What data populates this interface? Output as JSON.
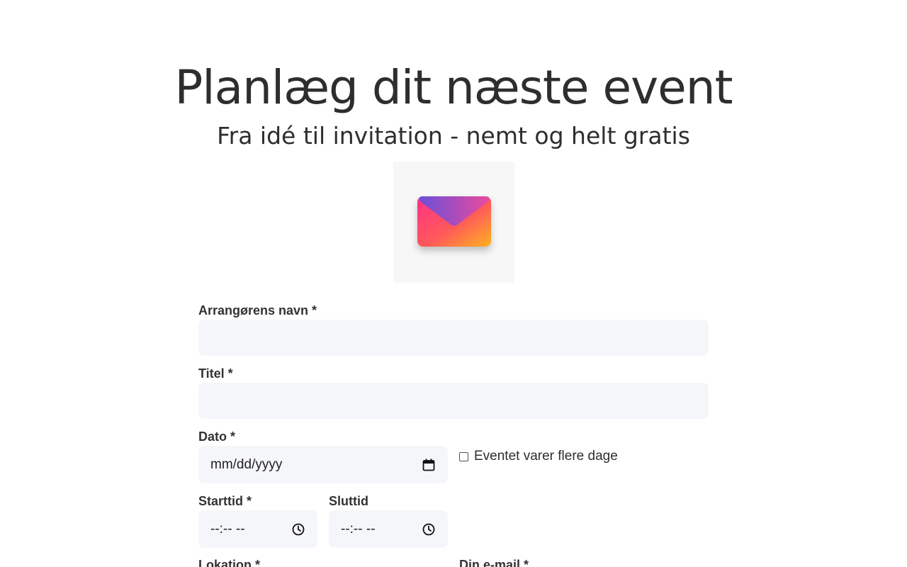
{
  "header": {
    "title": "Planlæg dit næste event",
    "subtitle": "Fra idé til invitation - nemt og helt gratis"
  },
  "hero": {
    "icon": "envelope-icon",
    "colors": {
      "envelope_body_from": "#ff3d7f",
      "envelope_body_to": "#ffb020",
      "envelope_flap_from": "#6b4fd8",
      "envelope_flap_to": "#e8459c",
      "background": "#f7f7f8"
    }
  },
  "form": {
    "organizer_name": {
      "label": "Arrangørens navn *",
      "value": ""
    },
    "title": {
      "label": "Titel *",
      "value": ""
    },
    "date": {
      "label": "Dato *",
      "placeholder": "mm/dd/yyyy",
      "icon": "calendar-icon"
    },
    "multi_day": {
      "label": "Eventet varer flere dage",
      "checked": false
    },
    "start_time": {
      "label": "Starttid *",
      "placeholder": "--:-- --",
      "icon": "clock-icon"
    },
    "end_time": {
      "label": "Sluttid",
      "placeholder": "--:-- --",
      "icon": "clock-icon"
    },
    "location": {
      "label": "Lokation *"
    },
    "email": {
      "label": "Din e-mail *"
    }
  },
  "colors": {
    "input_background": "#f5f6fa",
    "text": "#2e2e2e"
  }
}
